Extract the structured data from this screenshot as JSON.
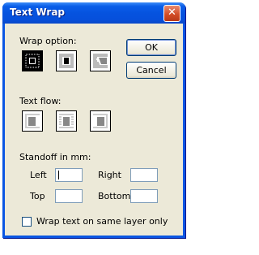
{
  "window": {
    "title": "Text Wrap"
  },
  "wrap_option": {
    "label": "Wrap option:",
    "icons": [
      "wrap-none-icon",
      "wrap-around-frame-icon",
      "wrap-irregular-icon"
    ],
    "selected_index": 0
  },
  "buttons": {
    "ok": "OK",
    "cancel": "Cancel"
  },
  "text_flow": {
    "label": "Text flow:",
    "icons": [
      "flow-left-icon",
      "flow-both-sides-icon",
      "flow-right-icon"
    ]
  },
  "standoff": {
    "label": "Standoff in  mm:",
    "left_label": "Left",
    "right_label": "Right",
    "top_label": "Top",
    "bottom_label": "Bottom",
    "left_value": "",
    "right_value": "",
    "top_value": "",
    "bottom_value": ""
  },
  "options": {
    "same_layer_label": "Wrap text on same layer only",
    "same_layer_checked": false
  }
}
